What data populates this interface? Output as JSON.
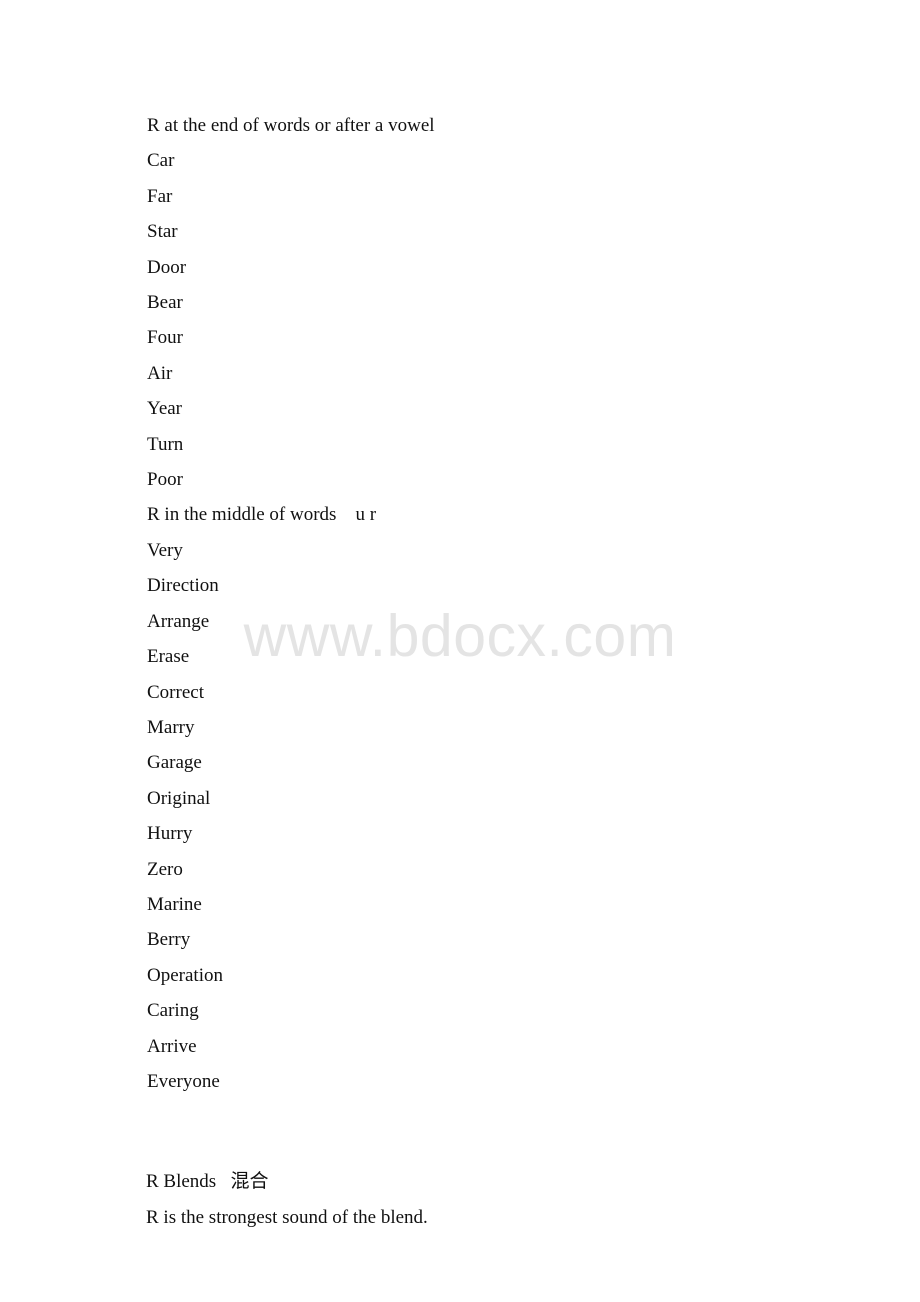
{
  "document": {
    "watermark": "www.bdocx.com",
    "sections": [
      {
        "heading": "R at the end of words or after a vowel",
        "words": [
          "Car",
          "Far",
          "Star",
          "Door",
          "Bear",
          "Four",
          "Air",
          "Year",
          "Turn",
          "Poor"
        ]
      },
      {
        "heading": "R in the middle of words    u r",
        "words": [
          "Very",
          "Direction",
          "Arrange",
          "Erase",
          "Correct",
          "Marry",
          "Garage",
          "Original",
          "Hurry",
          "Zero",
          "Marine",
          "Berry",
          "Operation",
          "Caring",
          "Arrive",
          "Everyone"
        ]
      }
    ],
    "blends": {
      "heading": "R Blends   混合",
      "note": "R is the strongest sound of the blend."
    }
  }
}
